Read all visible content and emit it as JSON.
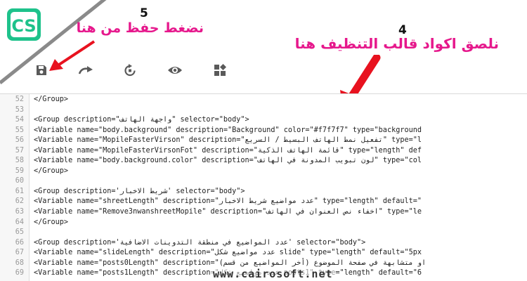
{
  "annotations": {
    "step5_number": "5",
    "step5_text": "نضغط حفظ من هنا",
    "step4_number": "4",
    "step4_text": "نلصق اكواد قالب التنظيف هنا"
  },
  "toolbar": {
    "buttons": [
      {
        "icon": "save-icon"
      },
      {
        "icon": "redo-icon"
      },
      {
        "icon": "restore-icon"
      },
      {
        "icon": "preview-eye-icon"
      },
      {
        "icon": "layout-widgets-icon"
      }
    ]
  },
  "logo": {
    "text": "CS",
    "color": "#1ec28b"
  },
  "colors": {
    "annotation": "#e6188c",
    "arrow": "#e8121f"
  },
  "editor": {
    "lines": [
      {
        "n": "52",
        "code": "</Group>"
      },
      {
        "n": "53",
        "code": ""
      },
      {
        "n": "54",
        "code": "<Group description=\"واجهة الهاتف\" selector=\"body\">"
      },
      {
        "n": "55",
        "code": "<Variable name=\"body.background\" description=\"Background\" color=\"#f7f7f7\" type=\"background"
      },
      {
        "n": "56",
        "code": "<Variable name=\"MopileFasterVirson\" description=\"تفعيل نمط الهاتف البسيط / السريع\" type=\"l"
      },
      {
        "n": "57",
        "code": "<Variable name=\"MopileFasterVirsonFot\" description=\"قائمة الهاتف الذكية\" type=\"length\" def"
      },
      {
        "n": "58",
        "code": "<Variable name=\"body.background.color\" description=\"لون تبويب المدونة في الهاتف\" type=\"col"
      },
      {
        "n": "59",
        "code": "</Group>"
      },
      {
        "n": "60",
        "code": ""
      },
      {
        "n": "61",
        "code": "<Group description='شريط الاخبار' selector=\"body\">"
      },
      {
        "n": "62",
        "code": "<Variable name=\"shreetLength\" description=\"عدد مواضيع شريط الاخبار\" type=\"length\" default=\""
      },
      {
        "n": "63",
        "code": "<Variable name=\"Remove3nwanshreetMopile\" description=\"اخفاء نص العنوان في الهاتف\" type=\"le"
      },
      {
        "n": "64",
        "code": "</Group>"
      },
      {
        "n": "65",
        "code": ""
      },
      {
        "n": "66",
        "code": "<Group description='عدد المواضيع في منطقة التدوينات الاضافية' selector=\"body\">"
      },
      {
        "n": "67",
        "code": "<Variable name=\"slideLength\" description=\"عدد مواضيع شكل slide\" type=\"length\" default=\"5px"
      },
      {
        "n": "68",
        "code": "<Variable name=\"posts0Length\" description=\"(أخر المواضيع من قسم) او متشابهة في صفحة الموضوع"
      },
      {
        "n": "69",
        "code": "<Variable name=\"posts1Length\" description=\"عدد مواضيع شكل posts1\" type=\"length\" default=\"6"
      }
    ]
  },
  "watermark": "www.cairosoft.net"
}
